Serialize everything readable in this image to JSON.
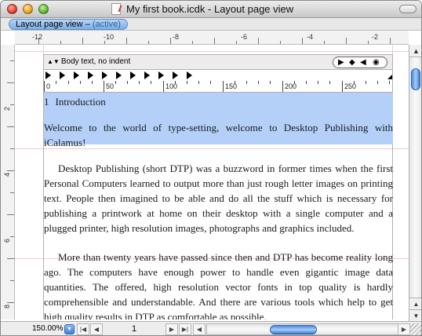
{
  "window": {
    "title": "My first book.icdk - Layout page view"
  },
  "tab": {
    "label": "Layout page view",
    "separator": " – ",
    "state": "(active)"
  },
  "top_ruler": {
    "labels": [
      "-12",
      "-10",
      "-8",
      "-6",
      "-4",
      "-2"
    ]
  },
  "left_ruler": {
    "labels": [
      "2",
      "4",
      "6",
      "8"
    ]
  },
  "frame_toolbar": {
    "paragraph_style": "Body text, no indent"
  },
  "frame_ruler": {
    "labels": [
      "0",
      "50",
      "100",
      "150",
      "200",
      "250"
    ]
  },
  "content": {
    "heading_number": "1",
    "heading_text": "Introduction",
    "selected_paragraph": "Welcome to the world of type-setting, welcome to Desktop Publishing with iCalamus!",
    "paragraph1": "Desktop Publishing (short DTP) was a buzzword in former times when the first Personal Computers learned to output more than just rough letter images on printing text. People then imagined to be able and do all the stuff which is necessary for publishing a printwork at home on their desktop with a single computer and a plugged printer, high resolution images, photographs and graphics included.",
    "paragraph2": "More than twenty years have passed since then and DTP has become reality long ago. The computers have enough power to handle even gigantic image data quantities. The offered, high resolution vector fonts in top quality is hardly comprehensible and understandable. And there are various tools which help to get high quality results in DTP as comfortable as possible."
  },
  "statusbar": {
    "zoom": "150.00%",
    "page": "1"
  },
  "colors": {
    "selection": "#b4d0f8",
    "accent": "#3f82d8",
    "guides": "#f1c9d0"
  }
}
